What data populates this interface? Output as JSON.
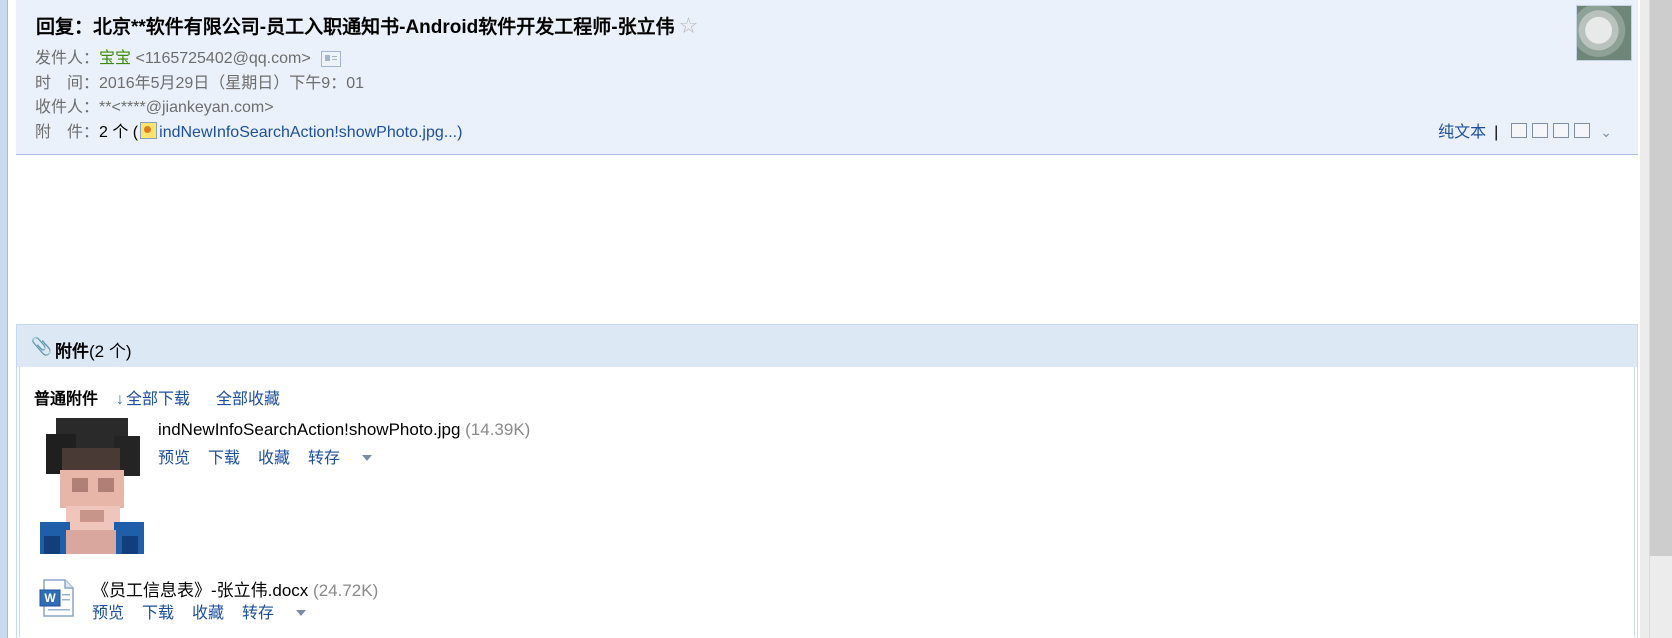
{
  "header": {
    "subject": "回复：北京**软件有限公司-员工入职通知书-Android软件开发工程师-张立伟",
    "from_label": "发件人：",
    "from_name": "宝宝",
    "from_email": "<1165725402@qq.com>",
    "time_label": "时　间：",
    "time_value": "2016年5月29日（星期日）下午9：01",
    "to_label": "收件人：",
    "to_value": "**<****@jiankeyan.com>",
    "attach_label": "附　件：",
    "attach_count": "2 个 (",
    "attach_link": "indNewInfoSearchAction!showPhoto.jpg...",
    "attach_close": ")"
  },
  "toolbar": {
    "plaintext_label": "纯文本",
    "separator": "|"
  },
  "attachments": {
    "title": "附件",
    "count": "(2 个)",
    "group_title": "普通附件",
    "download_all": "全部下载",
    "favorite_all": "全部收藏",
    "files": [
      {
        "name": "indNewInfoSearchAction!showPhoto.jpg",
        "size": "(14.39K)",
        "preview": "预览",
        "download": "下载",
        "favorite": "收藏",
        "save_to": "转存"
      },
      {
        "name": "《员工信息表》-张立伟.docx",
        "size": "(24.72K)",
        "preview": "预览",
        "download": "下载",
        "favorite": "收藏",
        "save_to": "转存"
      }
    ]
  },
  "icons": {
    "star": "star-icon",
    "contact_card": "contact-card-icon",
    "image_file": "image-file-icon",
    "paperclip": "paperclip-icon",
    "download_arrow": "download-arrow-icon",
    "word_doc": "word-document-icon"
  }
}
